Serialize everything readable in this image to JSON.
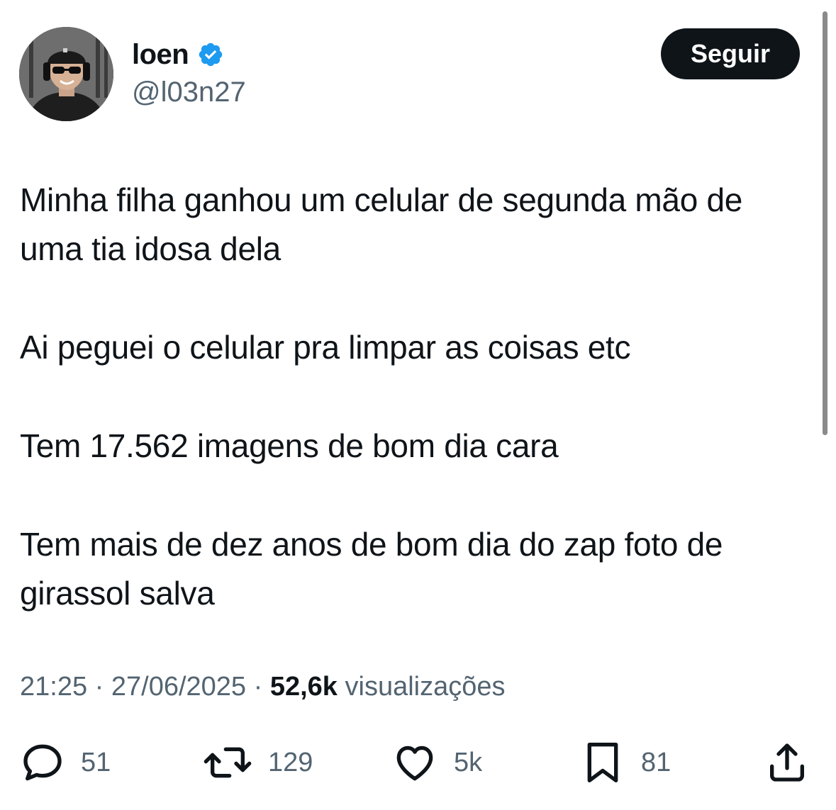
{
  "author": {
    "name": "loen",
    "handle": "@l03n27",
    "verified": true,
    "verified_color": "#1d9bf0"
  },
  "follow_button": {
    "label": "Seguir"
  },
  "tweet": {
    "paragraphs": [
      "Minha filha ganhou um celular de segunda mão de uma tia idosa dela",
      "Ai peguei o celular pra limpar as coisas etc",
      "Tem 17.562 imagens de bom dia cara",
      "Tem mais de dez anos de bom dia do zap foto de girassol salva"
    ]
  },
  "meta": {
    "time": "21:25",
    "separator": "·",
    "date": "27/06/2025",
    "views_count": "52,6k",
    "views_label": "visualizações"
  },
  "actions": {
    "reply": {
      "icon": "reply-icon",
      "count": "51"
    },
    "retweet": {
      "icon": "retweet-icon",
      "count": "129"
    },
    "like": {
      "icon": "heart-icon",
      "count": "5k"
    },
    "bookmark": {
      "icon": "bookmark-icon",
      "count": "81"
    },
    "share": {
      "icon": "share-icon"
    }
  },
  "colors": {
    "text_primary": "#0f1419",
    "text_secondary": "#536471",
    "button_bg": "#0f1419"
  }
}
